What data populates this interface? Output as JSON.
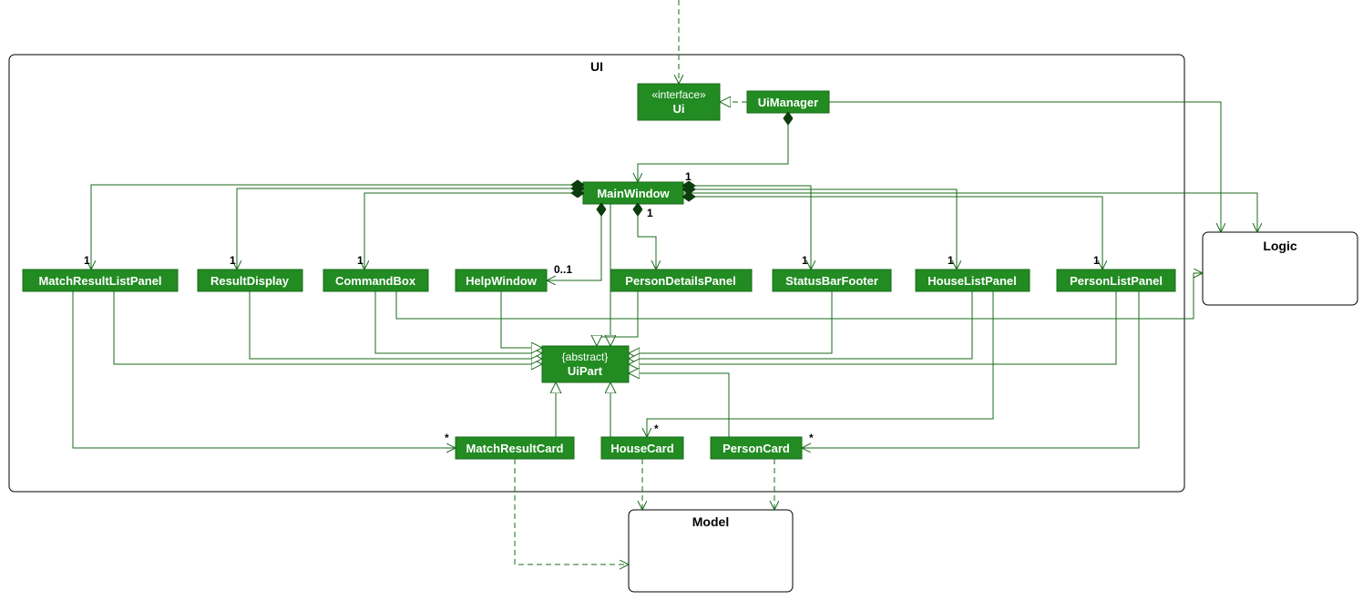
{
  "diagram": {
    "packages": {
      "ui": {
        "label": "UI"
      },
      "logic": {
        "label": "Logic"
      },
      "model": {
        "label": "Model"
      }
    },
    "classes": {
      "ui_iface": {
        "stereotype": "«interface»",
        "name": "Ui"
      },
      "uimanager": {
        "name": "UiManager"
      },
      "mainwindow": {
        "name": "MainWindow"
      },
      "uipart": {
        "stereotype": "{abstract}",
        "name": "UiPart"
      },
      "matchresultlistpanel": {
        "name": "MatchResultListPanel"
      },
      "resultdisplay": {
        "name": "ResultDisplay"
      },
      "commandbox": {
        "name": "CommandBox"
      },
      "helpwindow": {
        "name": "HelpWindow"
      },
      "persondetailspanel": {
        "name": "PersonDetailsPanel"
      },
      "statusbarfooter": {
        "name": "StatusBarFooter"
      },
      "houselistpanel": {
        "name": "HouseListPanel"
      },
      "personlistpanel": {
        "name": "PersonListPanel"
      },
      "matchresultcard": {
        "name": "MatchResultCard"
      },
      "housecard": {
        "name": "HouseCard"
      },
      "personcard": {
        "name": "PersonCard"
      }
    },
    "multiplicities": {
      "one": "1",
      "zero_one": "0..1",
      "many": "*"
    }
  }
}
